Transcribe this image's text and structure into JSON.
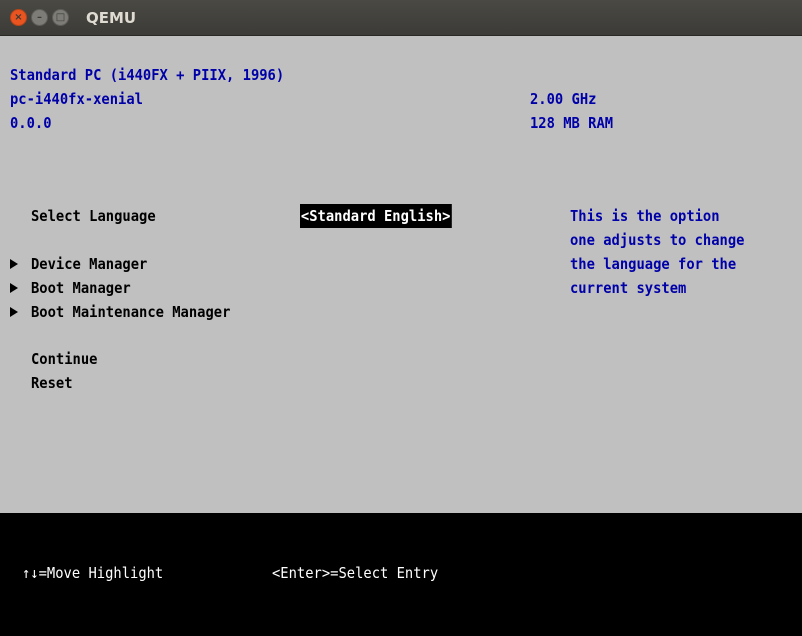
{
  "window": {
    "title": "QEMU",
    "buttons": {
      "close": "×",
      "minimize": "–",
      "maximize": "□"
    }
  },
  "system_info": {
    "machine": "Standard PC (i440FX + PIIX, 1996)",
    "board": "pc-i440fx-xenial",
    "version": "0.0.0",
    "cpu_speed": "2.00 GHz",
    "ram": "128 MB RAM"
  },
  "menu": {
    "language_label": "Select Language",
    "language_value": "<Standard English>",
    "items": [
      "Device Manager",
      "Boot Manager",
      "Boot Maintenance Manager"
    ],
    "continue": "Continue",
    "reset": "Reset"
  },
  "help": {
    "lines": [
      "This is the option",
      "one adjusts to change",
      "the language for the",
      "current system"
    ]
  },
  "footer": {
    "move_hint": "↑↓=Move Highlight",
    "select_hint": "<Enter>=Select Entry"
  },
  "colors": {
    "background": "#c0c0c0",
    "info_text": "#0000a8",
    "footer_bg": "#000000",
    "highlight_bg": "#000000",
    "highlight_text": "#ffffff"
  }
}
